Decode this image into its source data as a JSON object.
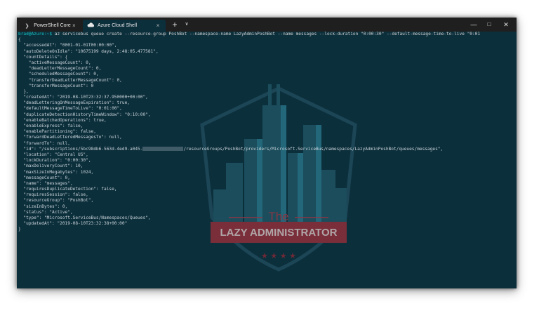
{
  "tabs": [
    {
      "icon": "powershell-icon",
      "label": "PowerShell Core",
      "active": false
    },
    {
      "icon": "azure-cloud-icon",
      "label": "Azure Cloud Shell",
      "active": true
    }
  ],
  "titlebar": {
    "close_glyph": "×",
    "new_tab_glyph": "+",
    "dropdown_glyph": "∨",
    "minimize_glyph": "—",
    "maximize_glyph": "□",
    "window_close_glyph": "✕"
  },
  "terminal": {
    "prompt": "brad@Azure:~$",
    "command": " az servicebus queue create --resource-group PoshBot --namespace-name LazyAdminPoshBot --name messages --lock-duration \"0:00:30\" --default-message-time-to-live \"0:01",
    "output_lines": [
      "{",
      "  \"accessedAt\": \"0001-01-01T00:00:00\",",
      "  \"autoDeleteOnIdle\": \"10675199 days, 2:48:05.477581\",",
      "  \"countDetails\": {",
      "    \"activeMessageCount\": 0,",
      "    \"deadLetterMessageCount\": 0,",
      "    \"scheduledMessageCount\": 0,",
      "    \"transferDeadLetterMessageCount\": 0,",
      "    \"transferMessageCount\": 0",
      "  },",
      "  \"createdAt\": \"2019-08-10T23:32:37.950000+00:00\",",
      "  \"deadLetteringOnMessageExpiration\": true,",
      "  \"defaultMessageTimeToLive\": \"0:01:00\",",
      "  \"duplicateDetectionHistoryTimeWindow\": \"0:10:00\",",
      "  \"enableBatchedOperations\": true,",
      "  \"enableExpress\": false,",
      "  \"enablePartitioning\": false,",
      "  \"forwardDeadLetteredMessagesTo\": null,",
      "  \"forwardTo\": null,",
      "  \"id\": \"/subscriptions/5bc98db6-563d-4ed9-a045-",
      "  \"location\": \"Central US\",",
      "  \"lockDuration\": \"0:00:30\",",
      "  \"maxDeliveryCount\": 10,",
      "  \"maxSizeInMegabytes\": 1024,",
      "  \"messageCount\": 0,",
      "  \"name\": \"messages\",",
      "  \"requiresDuplicateDetection\": false,",
      "  \"requiresSession\": false,",
      "  \"resourceGroup\": \"PoshBot\",",
      "  \"sizeInBytes\": 0,",
      "  \"status\": \"Active\",",
      "  \"type\": \"Microsoft.ServiceBus/Namespaces/Queues\",",
      "  \"updatedAt\": \"2019-08-10T23:32:38+00:00\"",
      "}"
    ],
    "id_suffix": "/resourceGroups/PoshBot/providers/Microsoft.ServiceBus/namespaces/LazyAdminPoshBot/queues/messages\","
  },
  "watermark": {
    "line1": "The",
    "line2": "LAZY ADMINISTRATOR",
    "stars": "★ ★ ★ ★"
  },
  "colors": {
    "terminal_bg": "#0c2f3c",
    "titlebar_bg": "#1f1f1f",
    "prompt": "#16c2c2",
    "text": "#c9d3d8",
    "banner": "#7a2e3a"
  }
}
